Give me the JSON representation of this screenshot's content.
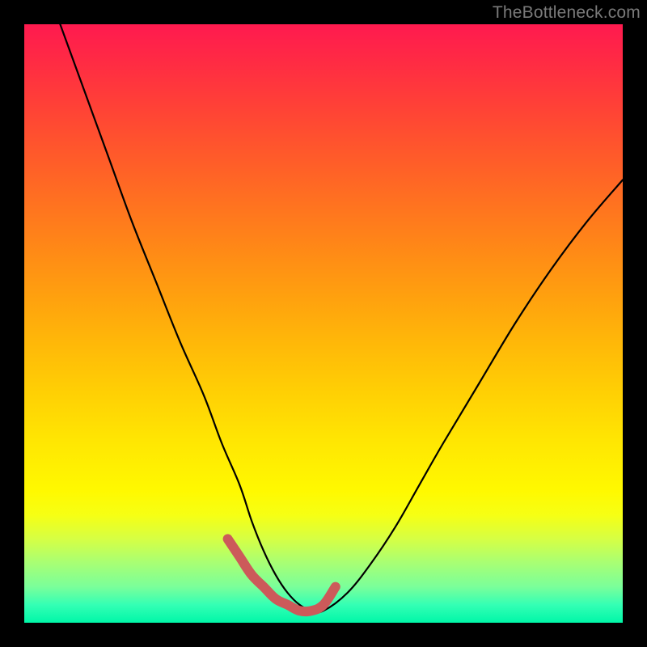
{
  "watermark": "TheBottleneck.com",
  "chart_data": {
    "type": "line",
    "title": "",
    "xlabel": "",
    "ylabel": "",
    "xlim": [
      0,
      100
    ],
    "ylim": [
      0,
      100
    ],
    "grid": false,
    "series": [
      {
        "name": "main-curve",
        "color": "#000000",
        "x": [
          6,
          10,
          14,
          18,
          22,
          26,
          30,
          33,
          36,
          38,
          40,
          42,
          44,
          46,
          48,
          50,
          54,
          58,
          62,
          66,
          70,
          76,
          82,
          88,
          94,
          100
        ],
        "y": [
          100,
          89,
          78,
          67,
          57,
          47,
          38,
          30,
          23,
          17,
          12,
          8,
          5,
          3,
          2,
          2,
          5,
          10,
          16,
          23,
          30,
          40,
          50,
          59,
          67,
          74
        ]
      },
      {
        "name": "highlight-segment",
        "color": "#cc5a5a",
        "x": [
          34,
          36,
          38,
          40,
          42,
          44,
          46,
          48,
          50,
          52
        ],
        "y": [
          14,
          11,
          8,
          6,
          4,
          3,
          2,
          2,
          3,
          6
        ]
      }
    ]
  },
  "colors": {
    "background": "#000000",
    "watermark": "#7a7a7a",
    "curve": "#000000",
    "highlight": "#cc5a5a"
  }
}
